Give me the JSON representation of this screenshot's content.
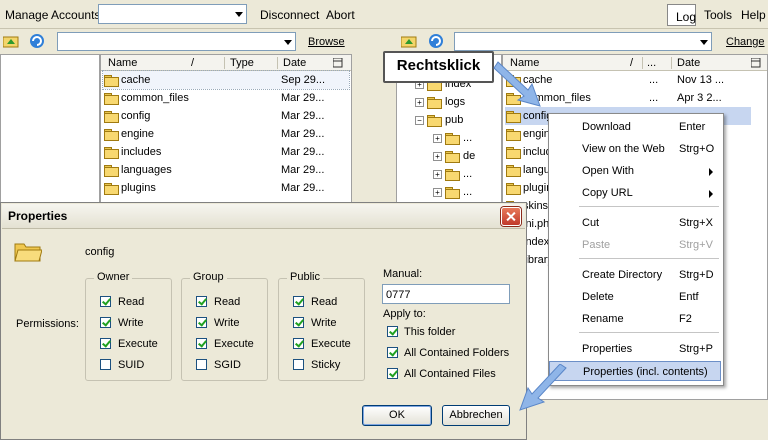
{
  "toolbar": {
    "manage_accounts": "Manage Accounts",
    "account_select_value": "",
    "disconnect": "Disconnect",
    "abort": "Abort",
    "log": "Log",
    "tools": "Tools",
    "help": "Help"
  },
  "local": {
    "path_value": "",
    "browse": "Browse",
    "columns": {
      "name": "Name",
      "sort": "/",
      "type": "Type",
      "date": "Date"
    },
    "rows": [
      {
        "name": "cache",
        "date": "Sep 29..."
      },
      {
        "name": "common_files",
        "date": "Mar 29..."
      },
      {
        "name": "config",
        "date": "Mar 29..."
      },
      {
        "name": "engine",
        "date": "Mar 29..."
      },
      {
        "name": "includes",
        "date": "Mar 29..."
      },
      {
        "name": "languages",
        "date": "Mar 29..."
      },
      {
        "name": "plugins",
        "date": "Mar 29..."
      }
    ]
  },
  "remote": {
    "path_value": "",
    "change": "Change",
    "tree": [
      "index",
      "logs",
      "pub",
      "...",
      "de",
      "...",
      "...",
      "..."
    ],
    "columns": {
      "name": "Name",
      "sort": "/",
      "ellipsis": "...",
      "date": "Date"
    },
    "rows": [
      {
        "name": "cache",
        "mid": "...",
        "date": "Nov 13 ..."
      },
      {
        "name": "common_files",
        "mid": "...",
        "date": "Apr 3 2..."
      },
      {
        "name": "config",
        "mid": "",
        "date": ""
      },
      {
        "name": "engine",
        "mid": "",
        "date": ""
      },
      {
        "name": "includes",
        "mid": "",
        "date": ""
      },
      {
        "name": "languages",
        "mid": "",
        "date": ""
      },
      {
        "name": "plugins",
        "mid": "",
        "date": ""
      },
      {
        "name": "skins",
        "mid": "",
        "date": "..."
      },
      {
        "name": "ini.php",
        "mid": "",
        "date": "-..."
      },
      {
        "name": "index",
        "mid": "",
        "date": "-..."
      },
      {
        "name": "library",
        "mid": "",
        "date": "-..."
      }
    ]
  },
  "callout": "Rechtsklick",
  "context_menu": {
    "items": [
      {
        "label": "Download",
        "shortcut": "Enter"
      },
      {
        "label": "View on the Web",
        "shortcut": "Strg+O"
      },
      {
        "label": "Open With",
        "shortcut": ""
      },
      {
        "label": "Copy URL",
        "shortcut": ""
      },
      {
        "label": "Cut",
        "shortcut": "Strg+X"
      },
      {
        "label": "Paste",
        "shortcut": "Strg+V"
      },
      {
        "label": "Create Directory",
        "shortcut": "Strg+D"
      },
      {
        "label": "Delete",
        "shortcut": "Entf"
      },
      {
        "label": "Rename",
        "shortcut": "F2"
      },
      {
        "label": "Properties",
        "shortcut": "Strg+P"
      },
      {
        "label": "Properties (incl. contents)",
        "shortcut": ""
      }
    ]
  },
  "dialog": {
    "title": "Properties",
    "file_name": "config",
    "permissions_label": "Permissions:",
    "owner": {
      "title": "Owner",
      "read": "Read",
      "write": "Write",
      "execute": "Execute",
      "special": "SUID"
    },
    "group": {
      "title": "Group",
      "read": "Read",
      "write": "Write",
      "execute": "Execute",
      "special": "SGID"
    },
    "public": {
      "title": "Public",
      "read": "Read",
      "write": "Write",
      "execute": "Execute",
      "special": "Sticky"
    },
    "manual_label": "Manual:",
    "manual_value": "0777",
    "apply_to": "Apply to:",
    "apply_this": "This folder",
    "apply_folders": "All Contained Folders",
    "apply_files": "All Contained Files",
    "ok": "OK",
    "cancel": "Abbrechen"
  }
}
